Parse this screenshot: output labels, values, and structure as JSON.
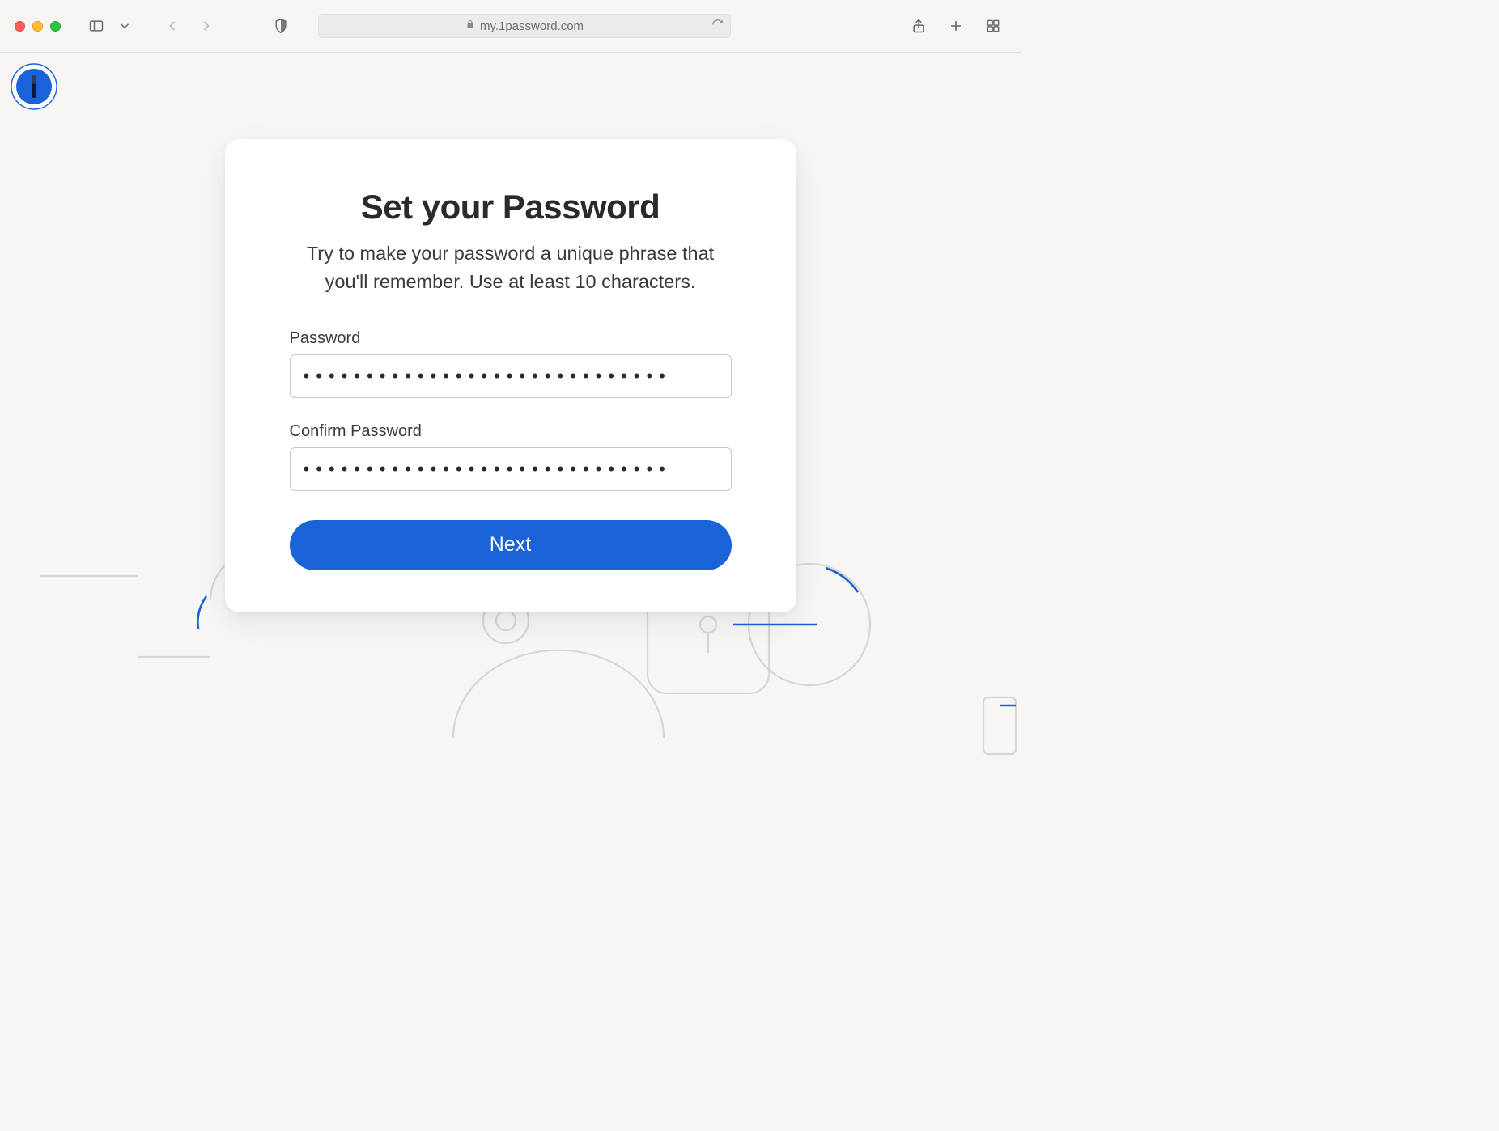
{
  "browser": {
    "url": "my.1password.com"
  },
  "card": {
    "title": "Set your Password",
    "subtitle": "Try to make your password a unique phrase that you'll remember. Use at least 10 characters.",
    "password_label": "Password",
    "password_value": "•••••••••••••••••••••••••••••",
    "confirm_label": "Confirm Password",
    "confirm_value": "•••••••••••••••••••••••••••••",
    "next_label": "Next"
  }
}
